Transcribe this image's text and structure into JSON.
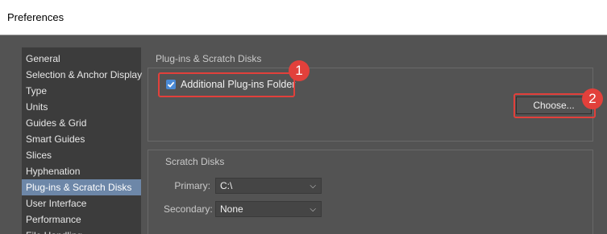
{
  "window": {
    "title": "Preferences"
  },
  "sidebar": {
    "items": [
      {
        "label": "General"
      },
      {
        "label": "Selection & Anchor Display"
      },
      {
        "label": "Type"
      },
      {
        "label": "Units"
      },
      {
        "label": "Guides & Grid"
      },
      {
        "label": "Smart Guides"
      },
      {
        "label": "Slices"
      },
      {
        "label": "Hyphenation"
      },
      {
        "label": "Plug-ins & Scratch Disks",
        "selected": true
      },
      {
        "label": "User Interface"
      },
      {
        "label": "Performance"
      },
      {
        "label": "File Handling"
      }
    ]
  },
  "panel": {
    "heading": "Plug-ins & Scratch Disks",
    "plugins": {
      "checkbox_label": "Additional Plug-ins Folder",
      "checked": true,
      "choose_label": "Choose..."
    },
    "scratch": {
      "heading": "Scratch Disks",
      "primary_label": "Primary:",
      "primary_value": "C:\\",
      "secondary_label": "Secondary:",
      "secondary_value": "None"
    }
  },
  "annotations": {
    "badge_1": "1",
    "badge_2": "2"
  },
  "colors": {
    "highlight": "#e2403b",
    "selected": "#6d87a8",
    "checkbox": "#4a8ad6"
  }
}
